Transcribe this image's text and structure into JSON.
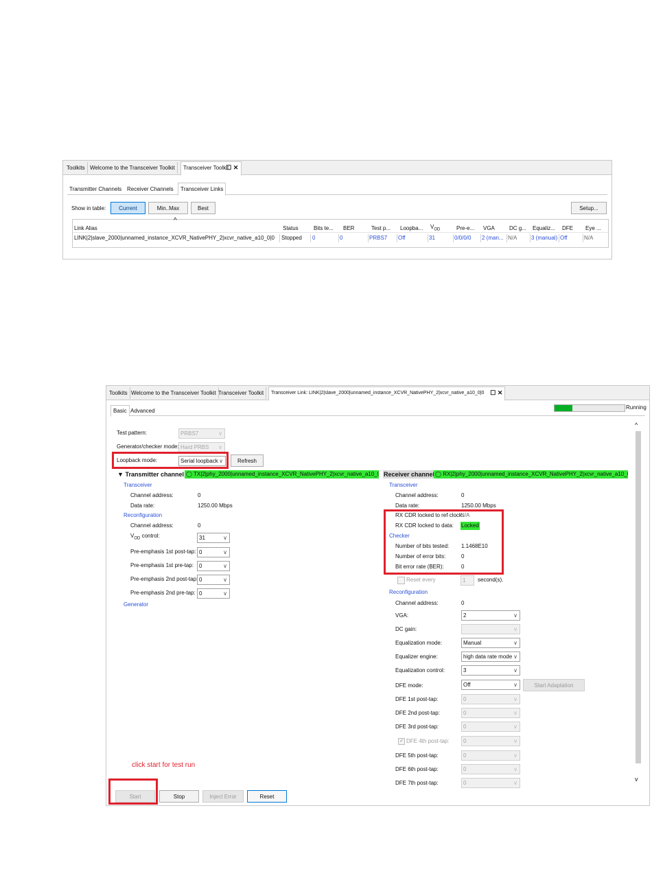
{
  "panel1": {
    "tabs": [
      "Toolkits",
      "Welcome to the Transceiver Toolkit",
      "Transceiver Toolkit"
    ],
    "close_glyphs": "☐ ✕",
    "subtabs": [
      "Transmitter Channels",
      "Receiver Channels",
      "Transceiver Links"
    ],
    "show_in_table_label": "Show in table:",
    "buttons": {
      "current": "Current",
      "minmax": "Min..Max",
      "best": "Best",
      "setup": "Setup..."
    },
    "sort_glyph": "^",
    "columns": [
      "Link Alias",
      "Status",
      "Bits te...",
      "BER",
      "Test p...",
      "Loopba...",
      "VOD",
      "Pre-e...",
      "VGA",
      "DC g...",
      "Equaliz...",
      "DFE",
      "Eye ..."
    ],
    "row": [
      "LINK|2|slave_2000|unnamed_instance_XCVR_NativePHY_2|xcvr_native_a10_0|0",
      "Stopped",
      "0",
      "0",
      "PRBS7",
      "Off",
      "31",
      "0/0/0/0",
      "2 (man...",
      "N/A",
      "3 (manual)",
      "Off",
      "N/A"
    ]
  },
  "panel2": {
    "tabs": [
      "Toolkits",
      "Welcome to the Transceiver Toolkit",
      "Transceiver Toolkit",
      "Transceiver Link: LINK|2|slave_2000|unnamed_instance_XCVR_NativePHY_2|xcvr_native_a10_0|0"
    ],
    "close_glyphs": "☐ ✕",
    "subtabs": [
      "Basic",
      "Advanced"
    ],
    "status": "Running",
    "progress": 0.25,
    "test_pattern_label": "Test pattern:",
    "test_pattern_value": "PRBS7",
    "gen_mode_label": "Generator/checker mode:",
    "gen_mode_value": "Hard PRBS",
    "loopback_label": "Loopback mode:",
    "loopback_value": "Serial loopback",
    "refresh": "Refresh",
    "tx": {
      "header": "Transmitter channel:",
      "channel_name": "TX|2|phy_2000|unnamed_instance_XCVR_NativePHY_2|xcvr_native_a10_0|0",
      "transceiver": "Transceiver",
      "channel_address_label": "Channel address:",
      "channel_address_value": "0",
      "data_rate_label": "Data rate:",
      "data_rate_value": "1250.00 Mbps",
      "reconfiguration": "Reconfiguration",
      "recfg_address_label": "Channel address:",
      "recfg_address_value": "0",
      "vod_label": "VOD control:",
      "vod_value": "31",
      "pre1_label": "Pre-emphasis 1st post-tap:",
      "pre1_value": "0",
      "pre2_label": "Pre-emphasis 1st pre-tap:",
      "pre2_value": "0",
      "pre3_label": "Pre-emphasis 2nd post-tap:",
      "pre3_value": "0",
      "pre4_label": "Pre-emphasis 2nd pre-tap:",
      "pre4_value": "0",
      "generator": "Generator"
    },
    "rx": {
      "header": "Receiver channel:",
      "channel_name": "RX|2|phy_2000|unnamed_instance_XCVR_NativePHY_2|xcvr_native_a10_0|0",
      "transceiver": "Transceiver",
      "channel_address_label": "Channel address:",
      "channel_address_value": "0",
      "data_rate_label": "Data rate:",
      "data_rate_value": "1250.00 Mbps",
      "cdr_ref_label": "RX CDR locked to ref clock:",
      "cdr_ref_value": "N/A",
      "cdr_data_label": "RX CDR locked to data:",
      "cdr_data_value": "Locked",
      "checker": "Checker",
      "bits_tested_label": "Number of bits tested:",
      "bits_tested_value": "1.1468E10",
      "error_bits_label": "Number of error bits:",
      "error_bits_value": "0",
      "ber_label": "Bit error rate (BER):",
      "ber_value": "0",
      "reset_every_label": "Reset every",
      "reset_every_value": "1",
      "seconds_label": "second(s).",
      "reconfiguration": "Reconfiguration",
      "recfg_address_label": "Channel address:",
      "recfg_address_value": "0",
      "vga_label": "VGA:",
      "vga_value": "2",
      "dc_gain_label": "DC gain:",
      "dc_gain_value": "",
      "eq_mode_label": "Equalization mode:",
      "eq_mode_value": "Manual",
      "eq_engine_label": "Equalizer engine:",
      "eq_engine_value": "high data rate mode",
      "eq_control_label": "Equalization control:",
      "eq_control_value": "3",
      "dfe_mode_label": "DFE mode:",
      "dfe_mode_value": "Off",
      "start_adaptation": "Start Adaptation",
      "dfe_taps": [
        {
          "label": "DFE 1st post-tap:",
          "value": "0"
        },
        {
          "label": "DFE 2nd post-tap:",
          "value": "0"
        },
        {
          "label": "DFE 3rd post-tap:",
          "value": "0"
        },
        {
          "label": "DFE 4th post-tap:",
          "value": "0"
        },
        {
          "label": "DFE 5th post-tap:",
          "value": "0"
        },
        {
          "label": "DFE 6th post-tap:",
          "value": "0"
        },
        {
          "label": "DFE 7th post-tap:",
          "value": "0"
        }
      ]
    },
    "annotation": "click start for test run",
    "bottom_buttons": {
      "start": "Start",
      "stop": "Stop",
      "inject": "Inject Error",
      "reset": "Reset"
    }
  },
  "colors": {
    "annotation_red": "#e0202c",
    "highlight_green": "#33e633",
    "link_blue": "#2a4fd6"
  }
}
